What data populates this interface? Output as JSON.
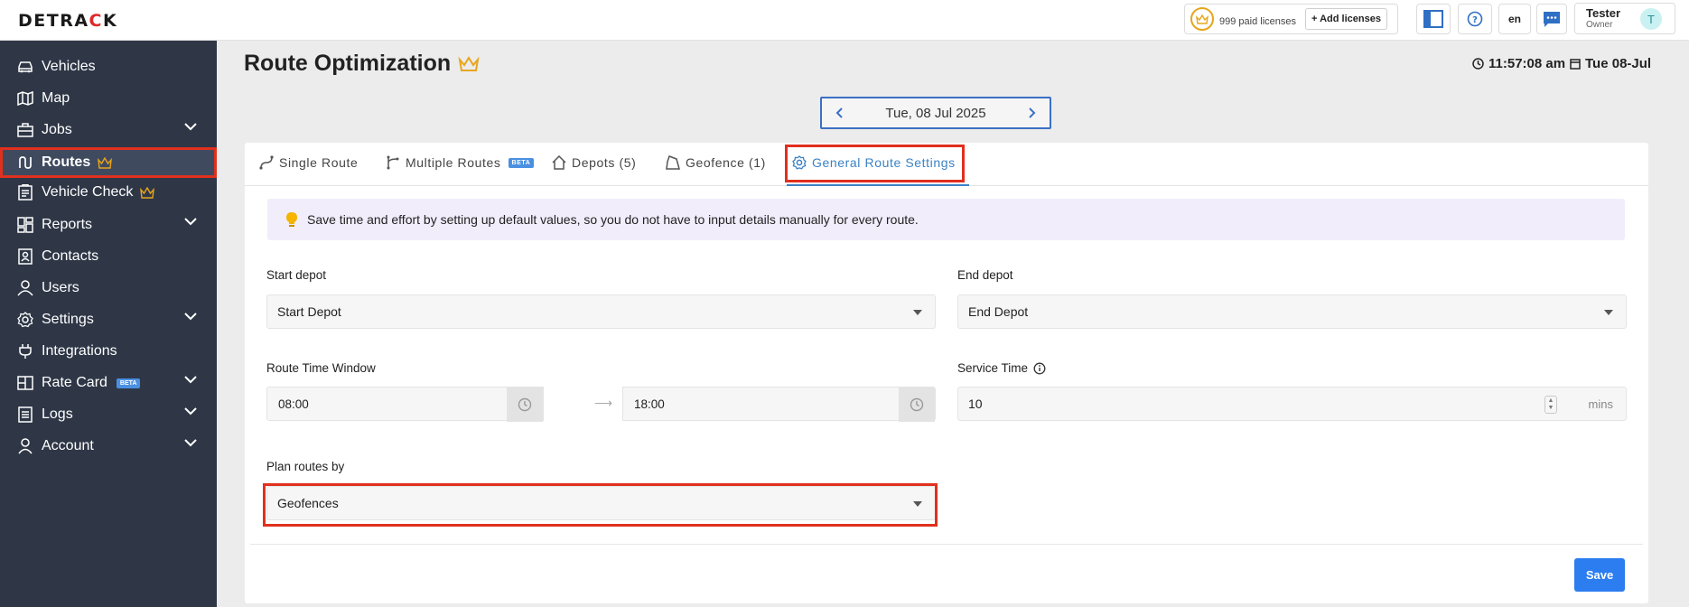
{
  "app": {
    "logo_text": "DETRACK",
    "licenses_text": "999 paid licenses",
    "add_licenses_label": "+ Add licenses",
    "language": "en",
    "user_name": "Tester",
    "user_role": "Owner",
    "avatar_initial": "T",
    "accent_color": "#3b82c4",
    "highlight_color": "#e0301e"
  },
  "sidebar": {
    "items": [
      {
        "label": "Vehicles",
        "icon": "car-icon"
      },
      {
        "label": "Map",
        "icon": "map-icon"
      },
      {
        "label": "Jobs",
        "icon": "briefcase-icon"
      },
      {
        "label": "Routes",
        "icon": "route-icon"
      },
      {
        "label": "Vehicle Check",
        "icon": "checklist-icon"
      },
      {
        "label": "Reports",
        "icon": "dashboard-icon"
      },
      {
        "label": "Contacts",
        "icon": "contact-book-icon"
      },
      {
        "label": "Users",
        "icon": "user-icon"
      },
      {
        "label": "Settings",
        "icon": "gear-icon"
      },
      {
        "label": "Integrations",
        "icon": "plug-icon"
      },
      {
        "label": "Rate Card",
        "icon": "rate-card-icon",
        "badge": "BETA"
      },
      {
        "label": "Logs",
        "icon": "log-icon"
      },
      {
        "label": "Account",
        "icon": "account-icon"
      }
    ]
  },
  "header": {
    "title": "Route Optimization",
    "time": "11:57:08 am",
    "date": "Tue 08-Jul",
    "date_nav": "Tue, 08 Jul 2025"
  },
  "tabs": [
    {
      "label": "Single Route"
    },
    {
      "label": "Multiple Routes",
      "badge": "BETA"
    },
    {
      "label": "Depots (5)"
    },
    {
      "label": "Geofence (1)"
    },
    {
      "label": "General Route Settings"
    }
  ],
  "form": {
    "info_text": "Save time and effort by setting up default values, so you do not have to input details manually for every route.",
    "start_depot_label": "Start depot",
    "start_depot_value": "Start Depot",
    "end_depot_label": "End depot",
    "end_depot_value": "End Depot",
    "time_window_label": "Route Time Window",
    "time_start": "08:00",
    "time_end": "18:00",
    "service_time_label": "Service Time",
    "service_time_value": "10",
    "service_time_unit": "mins",
    "plan_by_label": "Plan routes by",
    "plan_by_value": "Geofences",
    "save_label": "Save"
  }
}
